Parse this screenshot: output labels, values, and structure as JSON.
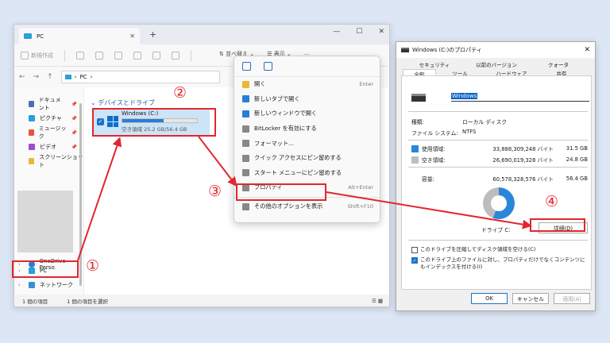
{
  "explorer": {
    "tab_title": "PC",
    "toolbar": {
      "new": "新規作成",
      "sort": "並べ替え",
      "view": "表示",
      "more": "..."
    },
    "address": "PC",
    "sidebar": [
      {
        "label": "ドキュメント",
        "color": "#4a6fb5"
      },
      {
        "label": "ピクチャ",
        "color": "#2a9fd8"
      },
      {
        "label": "ミュージック",
        "color": "#e8553b"
      },
      {
        "label": "ビデオ",
        "color": "#9b4dca"
      },
      {
        "label": "スクリーンショット",
        "color": "#e8b83b"
      }
    ],
    "onedrive": "OneDrive - Perso",
    "pc": "PC",
    "network": "ネットワーク",
    "group": "デバイスとドライブ",
    "drive": {
      "name": "Windows (C:)",
      "space": "空き領域 25.2 GB/56.4 GB",
      "used_fraction": 0.553
    },
    "status": {
      "count": "1 個の項目",
      "selected": "1 個の項目を選択"
    }
  },
  "context_menu": {
    "items": [
      {
        "label": "開く",
        "shortcut": "Enter",
        "color": "#e8b83b"
      },
      {
        "label": "新しいタブで開く",
        "shortcut": "",
        "color": "#2a7ed8"
      },
      {
        "label": "新しいウィンドウで開く",
        "shortcut": "",
        "color": "#2a7ed8"
      },
      {
        "label": "BitLocker を有効にする",
        "shortcut": "",
        "color": "#888888"
      },
      {
        "label": "フォーマット...",
        "shortcut": "",
        "color": "#888888"
      },
      {
        "label": "クイック アクセスにピン留めする",
        "shortcut": "",
        "color": "#888888"
      },
      {
        "label": "スタート メニューにピン留めする",
        "shortcut": "",
        "color": "#888888"
      },
      {
        "label": "プロパティ",
        "shortcut": "Alt+Enter",
        "color": "#888888"
      },
      {
        "label": "その他のオプションを表示",
        "shortcut": "Shift+F10",
        "color": "#888888"
      }
    ]
  },
  "props": {
    "title": "Windows (C:)のプロパティ",
    "tabs_top": [
      "セキュリティ",
      "以前のバージョン",
      "クォータ"
    ],
    "tabs_bottom": [
      "全般",
      "ツール",
      "ハードウェア",
      "共有"
    ],
    "name": "Windows",
    "type_label": "種類:",
    "type_value": "ローカル ディスク",
    "fs_label": "ファイル システム:",
    "fs_value": "NTFS",
    "used_label": "使用領域:",
    "used_bytes": "33,888,309,248 バイト",
    "used_gb": "31.5 GB",
    "free_label": "空き領域:",
    "free_bytes": "26,690,019,328 バイト",
    "free_gb": "24.8 GB",
    "cap_label": "容量:",
    "cap_bytes": "60,578,328,576 バイト",
    "cap_gb": "56.4 GB",
    "drive_label": "ドライブ C:",
    "detail": "詳細(D)",
    "compress": "このドライブを圧縮してディスク領域を空ける(C)",
    "index": "このドライブ上のファイルに対し、プロパティだけでなくコンテンツにもインデックスを付ける(I)",
    "ok": "OK",
    "cancel": "キャンセル",
    "apply": "適用(A)"
  },
  "annotations": {
    "n1": "①",
    "n2": "②",
    "n3": "③",
    "n4": "④"
  }
}
